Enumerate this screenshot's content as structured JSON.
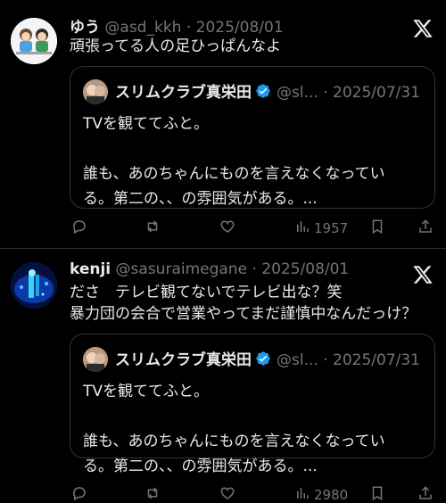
{
  "posts": [
    {
      "display_name": "ゆう",
      "handle": "@asd_kkh",
      "separator": "·",
      "date": "2025/08/01",
      "text_lines": [
        "頑張ってる人の足ひっぱんなよ"
      ],
      "quote": {
        "display_name": "スリムクラブ真栄田",
        "handle": "@sl...",
        "separator": "·",
        "date": "2025/07/31",
        "text_lines": [
          "TVを観ててふと。",
          "",
          "誰も、あのちゃんにものを言えなくなってい",
          "る。第二の、、の雰囲気がある。..."
        ]
      },
      "views": "1957"
    },
    {
      "display_name": "kenji",
      "handle": "@sasuraimegane",
      "separator": "·",
      "date": "2025/08/01",
      "text_lines": [
        "ださ　テレビ観てないでテレビ出な？笑",
        "暴力団の会合で営業やってまだ謹慎中なんだっけ？"
      ],
      "quote": {
        "display_name": "スリムクラブ真栄田",
        "handle": "@sl...",
        "separator": "·",
        "date": "2025/07/31",
        "text_lines": [
          "TVを観ててふと。",
          "",
          "誰も、あのちゃんにものを言えなくなってい",
          "る。第二の、、の雰囲気がある。..."
        ]
      },
      "views": "2980"
    }
  ],
  "icons": {
    "platform_logo": "x-logo-icon",
    "verified": "verified-badge-icon",
    "reply": "reply-icon",
    "repost": "repost-icon",
    "like": "heart-icon",
    "views": "views-bar-icon",
    "bookmark": "bookmark-icon",
    "share": "share-icon"
  },
  "colors": {
    "background": "#000000",
    "text_primary": "#e7e9ea",
    "text_secondary": "#71767b",
    "border": "#2f3336",
    "verified_blue": "#1d9bf0"
  }
}
